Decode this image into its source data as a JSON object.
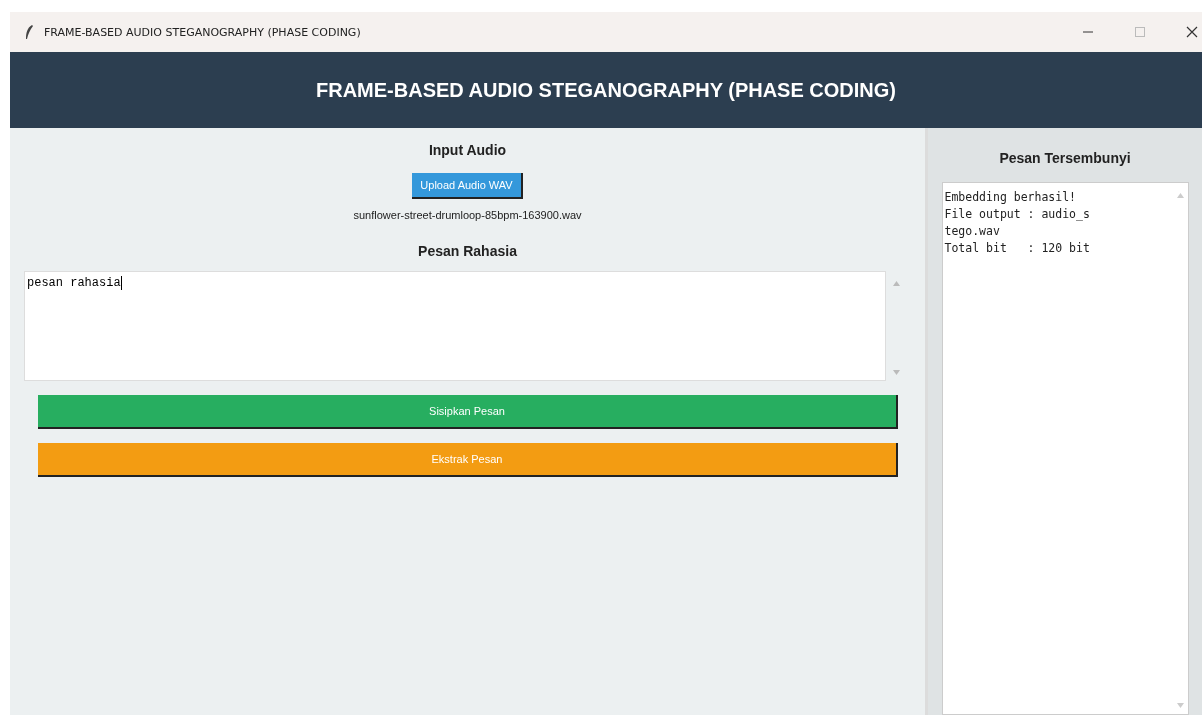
{
  "window": {
    "title": "FRAME-BASED AUDIO STEGANOGRAPHY (PHASE CODING)"
  },
  "header": {
    "title": "FRAME-BASED AUDIO STEGANOGRAPHY (PHASE CODING)"
  },
  "input_audio": {
    "heading": "Input Audio",
    "upload_button": "Upload Audio WAV",
    "file_name": "sunflower-street-drumloop-85bpm-163900.wav"
  },
  "secret_message": {
    "heading": "Pesan Rahasia",
    "value": "pesan rahasia"
  },
  "actions": [
    {
      "label": "Sisipkan Pesan",
      "color": "#27ae60"
    },
    {
      "label": "Ekstrak Pesan",
      "color": "#f39c12"
    }
  ],
  "hidden_message": {
    "heading": "Pesan Tersembunyi",
    "lines": [
      "Embedding berhasil!",
      "File output : audio_s",
      "tego.wav",
      "Total bit   : 120 bit"
    ]
  }
}
